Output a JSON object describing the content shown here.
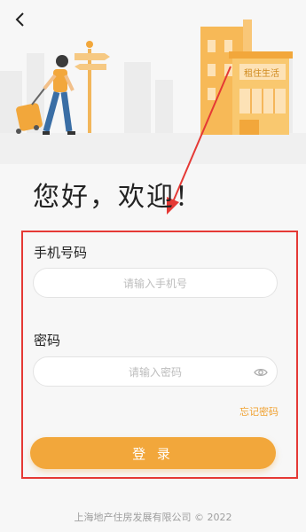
{
  "nav": {
    "back_icon": "chevron-left-icon"
  },
  "hero": {
    "shop_sign": "租住生活"
  },
  "greeting": "您好，欢迎！",
  "phone": {
    "label": "手机号码",
    "placeholder": "请输入手机号"
  },
  "password": {
    "label": "密码",
    "placeholder": "请输入密码",
    "toggle_icon": "eye-icon"
  },
  "forgot_password": "忘记密码",
  "login_button": "登 录",
  "footer": "上海地产住房发展有限公司 © 2022",
  "colors": {
    "accent": "#f2a73b",
    "annotation": "#e53935",
    "background": "#f7f7f7"
  }
}
